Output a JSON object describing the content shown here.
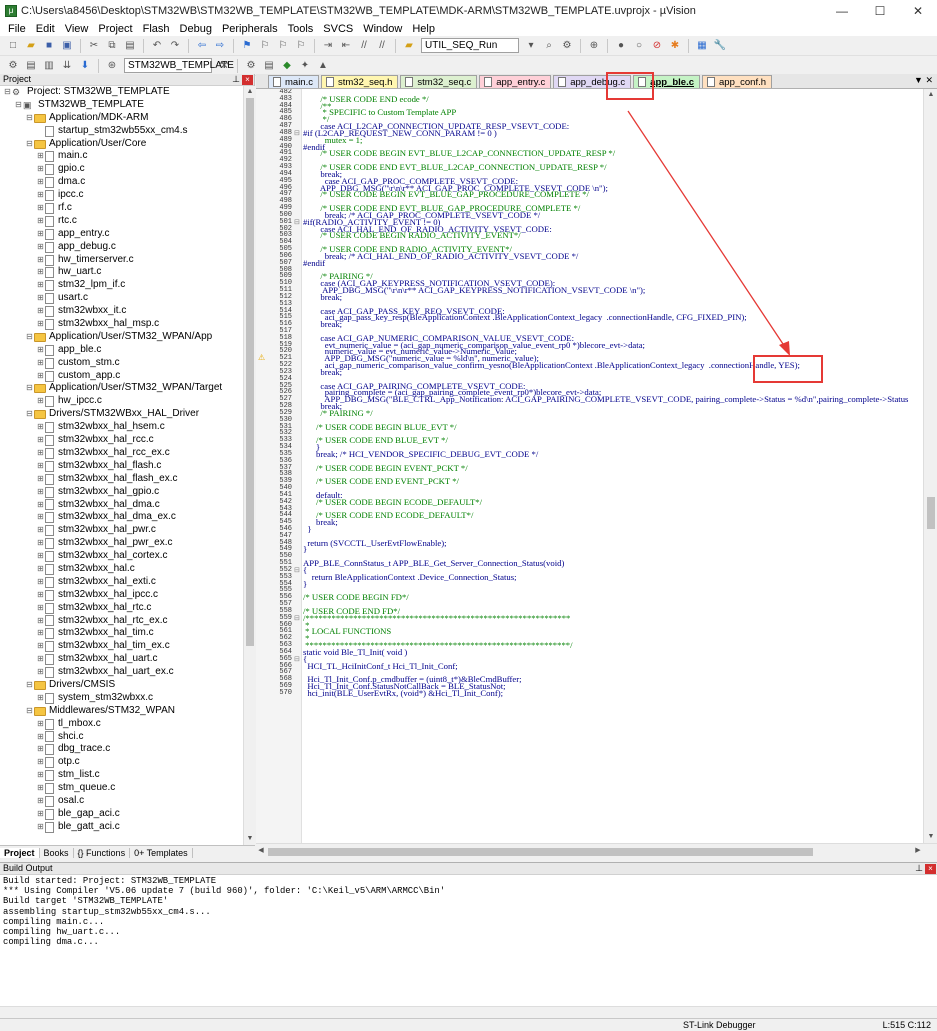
{
  "window": {
    "title": "C:\\Users\\a8456\\Desktop\\STM32WB\\STM32WB_TEMPLATE\\STM32WB_TEMPLATE\\MDK-ARM\\STM32WB_TEMPLATE.uvprojx - µVision",
    "minimize": "—",
    "maximize": "☐",
    "close": "✕"
  },
  "menu": [
    "File",
    "Edit",
    "View",
    "Project",
    "Flash",
    "Debug",
    "Peripherals",
    "Tools",
    "SVCS",
    "Window",
    "Help"
  ],
  "toolbar": {
    "function_combo": "UTIL_SEQ_Run",
    "target_combo": "STM32WB_TEMPLATE"
  },
  "project_panel": {
    "title": "Project",
    "tree": [
      {
        "level": 0,
        "type": "proj",
        "toggle": "⊟",
        "label": "Project: STM32WB_TEMPLATE"
      },
      {
        "level": 1,
        "type": "target",
        "toggle": "⊟",
        "label": "STM32WB_TEMPLATE"
      },
      {
        "level": 2,
        "type": "folder",
        "toggle": "⊟",
        "label": "Application/MDK-ARM"
      },
      {
        "level": 3,
        "type": "file",
        "toggle": "",
        "label": "startup_stm32wb55xx_cm4.s"
      },
      {
        "level": 2,
        "type": "folder",
        "toggle": "⊟",
        "label": "Application/User/Core"
      },
      {
        "level": 3,
        "type": "file",
        "toggle": "⊞",
        "label": "main.c"
      },
      {
        "level": 3,
        "type": "file",
        "toggle": "⊞",
        "label": "gpio.c"
      },
      {
        "level": 3,
        "type": "file",
        "toggle": "⊞",
        "label": "dma.c"
      },
      {
        "level": 3,
        "type": "file",
        "toggle": "⊞",
        "label": "ipcc.c"
      },
      {
        "level": 3,
        "type": "file",
        "toggle": "⊞",
        "label": "rf.c"
      },
      {
        "level": 3,
        "type": "file",
        "toggle": "⊞",
        "label": "rtc.c"
      },
      {
        "level": 3,
        "type": "file",
        "toggle": "⊞",
        "label": "app_entry.c"
      },
      {
        "level": 3,
        "type": "file",
        "toggle": "⊞",
        "label": "app_debug.c"
      },
      {
        "level": 3,
        "type": "file",
        "toggle": "⊞",
        "label": "hw_timerserver.c"
      },
      {
        "level": 3,
        "type": "file",
        "toggle": "⊞",
        "label": "hw_uart.c"
      },
      {
        "level": 3,
        "type": "file",
        "toggle": "⊞",
        "label": "stm32_lpm_if.c"
      },
      {
        "level": 3,
        "type": "file",
        "toggle": "⊞",
        "label": "usart.c"
      },
      {
        "level": 3,
        "type": "file",
        "toggle": "⊞",
        "label": "stm32wbxx_it.c"
      },
      {
        "level": 3,
        "type": "file",
        "toggle": "⊞",
        "label": "stm32wbxx_hal_msp.c"
      },
      {
        "level": 2,
        "type": "folder",
        "toggle": "⊟",
        "label": "Application/User/STM32_WPAN/App"
      },
      {
        "level": 3,
        "type": "file",
        "toggle": "⊞",
        "label": "app_ble.c"
      },
      {
        "level": 3,
        "type": "file",
        "toggle": "⊞",
        "label": "custom_stm.c"
      },
      {
        "level": 3,
        "type": "file",
        "toggle": "⊞",
        "label": "custom_app.c"
      },
      {
        "level": 2,
        "type": "folder",
        "toggle": "⊟",
        "label": "Application/User/STM32_WPAN/Target"
      },
      {
        "level": 3,
        "type": "file",
        "toggle": "⊞",
        "label": "hw_ipcc.c"
      },
      {
        "level": 2,
        "type": "folder",
        "toggle": "⊟",
        "label": "Drivers/STM32WBxx_HAL_Driver"
      },
      {
        "level": 3,
        "type": "file",
        "toggle": "⊞",
        "label": "stm32wbxx_hal_hsem.c"
      },
      {
        "level": 3,
        "type": "file",
        "toggle": "⊞",
        "label": "stm32wbxx_hal_rcc.c"
      },
      {
        "level": 3,
        "type": "file",
        "toggle": "⊞",
        "label": "stm32wbxx_hal_rcc_ex.c"
      },
      {
        "level": 3,
        "type": "file",
        "toggle": "⊞",
        "label": "stm32wbxx_hal_flash.c"
      },
      {
        "level": 3,
        "type": "file",
        "toggle": "⊞",
        "label": "stm32wbxx_hal_flash_ex.c"
      },
      {
        "level": 3,
        "type": "file",
        "toggle": "⊞",
        "label": "stm32wbxx_hal_gpio.c"
      },
      {
        "level": 3,
        "type": "file",
        "toggle": "⊞",
        "label": "stm32wbxx_hal_dma.c"
      },
      {
        "level": 3,
        "type": "file",
        "toggle": "⊞",
        "label": "stm32wbxx_hal_dma_ex.c"
      },
      {
        "level": 3,
        "type": "file",
        "toggle": "⊞",
        "label": "stm32wbxx_hal_pwr.c"
      },
      {
        "level": 3,
        "type": "file",
        "toggle": "⊞",
        "label": "stm32wbxx_hal_pwr_ex.c"
      },
      {
        "level": 3,
        "type": "file",
        "toggle": "⊞",
        "label": "stm32wbxx_hal_cortex.c"
      },
      {
        "level": 3,
        "type": "file",
        "toggle": "⊞",
        "label": "stm32wbxx_hal.c"
      },
      {
        "level": 3,
        "type": "file",
        "toggle": "⊞",
        "label": "stm32wbxx_hal_exti.c"
      },
      {
        "level": 3,
        "type": "file",
        "toggle": "⊞",
        "label": "stm32wbxx_hal_ipcc.c"
      },
      {
        "level": 3,
        "type": "file",
        "toggle": "⊞",
        "label": "stm32wbxx_hal_rtc.c"
      },
      {
        "level": 3,
        "type": "file",
        "toggle": "⊞",
        "label": "stm32wbxx_hal_rtc_ex.c"
      },
      {
        "level": 3,
        "type": "file",
        "toggle": "⊞",
        "label": "stm32wbxx_hal_tim.c"
      },
      {
        "level": 3,
        "type": "file",
        "toggle": "⊞",
        "label": "stm32wbxx_hal_tim_ex.c"
      },
      {
        "level": 3,
        "type": "file",
        "toggle": "⊞",
        "label": "stm32wbxx_hal_uart.c"
      },
      {
        "level": 3,
        "type": "file",
        "toggle": "⊞",
        "label": "stm32wbxx_hal_uart_ex.c"
      },
      {
        "level": 2,
        "type": "folder",
        "toggle": "⊟",
        "label": "Drivers/CMSIS"
      },
      {
        "level": 3,
        "type": "file",
        "toggle": "⊞",
        "label": "system_stm32wbxx.c"
      },
      {
        "level": 2,
        "type": "folder",
        "toggle": "⊟",
        "label": "Middlewares/STM32_WPAN"
      },
      {
        "level": 3,
        "type": "file",
        "toggle": "⊞",
        "label": "tl_mbox.c"
      },
      {
        "level": 3,
        "type": "file",
        "toggle": "⊞",
        "label": "shci.c"
      },
      {
        "level": 3,
        "type": "file",
        "toggle": "⊞",
        "label": "dbg_trace.c"
      },
      {
        "level": 3,
        "type": "file",
        "toggle": "⊞",
        "label": "otp.c"
      },
      {
        "level": 3,
        "type": "file",
        "toggle": "⊞",
        "label": "stm_list.c"
      },
      {
        "level": 3,
        "type": "file",
        "toggle": "⊞",
        "label": "stm_queue.c"
      },
      {
        "level": 3,
        "type": "file",
        "toggle": "⊞",
        "label": "osal.c"
      },
      {
        "level": 3,
        "type": "file",
        "toggle": "⊞",
        "label": "ble_gap_aci.c"
      },
      {
        "level": 3,
        "type": "file",
        "toggle": "⊞",
        "label": "ble_gatt_aci.c"
      }
    ],
    "tabs": [
      "Project",
      "Books",
      "{} Functions",
      "0+ Templates"
    ]
  },
  "editor_tabs": [
    {
      "label": "main.c",
      "color": "#dde8f8"
    },
    {
      "label": "stm32_seq.h",
      "color": "#fff6b0"
    },
    {
      "label": "stm32_seq.c",
      "color": "#ddf0d0"
    },
    {
      "label": "app_entry.c",
      "color": "#ffd0d8"
    },
    {
      "label": "app_debug.c",
      "color": "#e0d8f4"
    },
    {
      "label": "app_ble.c",
      "color": "#c5f3c5",
      "active": true
    },
    {
      "label": "app_conf.h",
      "color": "#ffe0c0"
    }
  ],
  "code": [
    {
      "n": "482",
      "g": "",
      "t": ""
    },
    {
      "n": "483",
      "g": "",
      "t": "        /* USER CODE END ecode */",
      "c": "cmt"
    },
    {
      "n": "484",
      "g": "",
      "t": "        /**",
      "c": "cmt"
    },
    {
      "n": "485",
      "g": "",
      "t": "         * SPECIFIC to Custom Template APP",
      "c": "cmt"
    },
    {
      "n": "486",
      "g": "",
      "t": "         */",
      "c": "cmt"
    },
    {
      "n": "487",
      "g": "",
      "t": "        case ACI_L2CAP_CONNECTION_UPDATE_RESP_VSEVT_CODE:"
    },
    {
      "n": "488",
      "g": "⊟",
      "t": "#if (L2CAP_REQUEST_NEW_CONN_PARAM != 0 )"
    },
    {
      "n": "489",
      "g": "",
      "t": "          mutex = 1;",
      "c": "cmt"
    },
    {
      "n": "490",
      "g": "",
      "t": "#endif"
    },
    {
      "n": "491",
      "g": "",
      "t": "        /* USER CODE BEGIN EVT_BLUE_L2CAP_CONNECTION_UPDATE_RESP */",
      "c": "cmt"
    },
    {
      "n": "492",
      "g": "",
      "t": ""
    },
    {
      "n": "493",
      "g": "",
      "t": "        /* USER CODE END EVT_BLUE_L2CAP_CONNECTION_UPDATE_RESP */",
      "c": "cmt"
    },
    {
      "n": "494",
      "g": "",
      "t": "        break;"
    },
    {
      "n": "495",
      "g": "",
      "t": "          case ACI_GAP_PROC_COMPLETE_VSEVT_CODE:"
    },
    {
      "n": "496",
      "g": "",
      "t": "        APP_DBG_MSG(\"\\r\\n\\r** ACI_GAP_PROC_COMPLETE_VSEVT_CODE \\n\");"
    },
    {
      "n": "497",
      "g": "",
      "t": "        /* USER CODE BEGIN EVT_BLUE_GAP_PROCEDURE_COMPLETE */",
      "c": "cmt"
    },
    {
      "n": "498",
      "g": "",
      "t": ""
    },
    {
      "n": "499",
      "g": "",
      "t": "        /* USER CODE END EVT_BLUE_GAP_PROCEDURE_COMPLETE */",
      "c": "cmt"
    },
    {
      "n": "500",
      "g": "",
      "t": "          break; /* ACI_GAP_PROC_COMPLETE_VSEVT_CODE */"
    },
    {
      "n": "501",
      "g": "⊟",
      "t": "#if(RADIO_ACTIVITY_EVENT != 0)"
    },
    {
      "n": "502",
      "g": "",
      "t": "        case ACI_HAL_END_OF_RADIO_ACTIVITY_VSEVT_CODE:"
    },
    {
      "n": "503",
      "g": "",
      "t": "        /* USER CODE BEGIN RADIO_ACTIVITY_EVENT*/",
      "c": "cmt"
    },
    {
      "n": "504",
      "g": "",
      "t": ""
    },
    {
      "n": "505",
      "g": "",
      "t": "        /* USER CODE END RADIO_ACTIVITY_EVENT*/",
      "c": "cmt"
    },
    {
      "n": "506",
      "g": "",
      "t": "          break; /* ACI_HAL_END_OF_RADIO_ACTIVITY_VSEVT_CODE */"
    },
    {
      "n": "507",
      "g": "",
      "t": "#endif"
    },
    {
      "n": "508",
      "g": "",
      "t": ""
    },
    {
      "n": "509",
      "g": "",
      "t": "        /* PAIRING */",
      "c": "cmt"
    },
    {
      "n": "510",
      "g": "",
      "t": "        case (ACI_GAP_KEYPRESS_NOTIFICATION_VSEVT_CODE):"
    },
    {
      "n": "511",
      "g": "",
      "t": "         APP_DBG_MSG(\"\\r\\n\\r** ACI_GAP_KEYPRESS_NOTIFICATION_VSEVT_CODE \\n\");"
    },
    {
      "n": "512",
      "g": "",
      "t": "        break;"
    },
    {
      "n": "513",
      "g": "",
      "t": ""
    },
    {
      "n": "514",
      "g": "",
      "t": "        case ACI_GAP_PASS_KEY_REQ_VSEVT_CODE:"
    },
    {
      "n": "515",
      "g": "",
      "t": "          aci_gap_pass_key_resp(BleApplicationContext .BleApplicationContext_legacy  .connectionHandle, CFG_FIXED_PIN);"
    },
    {
      "n": "516",
      "g": "",
      "t": "        break;"
    },
    {
      "n": "517",
      "g": "",
      "t": ""
    },
    {
      "n": "518",
      "g": "",
      "t": "        case ACI_GAP_NUMERIC_COMPARISON_VALUE_VSEVT_CODE:"
    },
    {
      "n": "519",
      "g": "",
      "t": "          evt_numeric_value = (aci_gap_numeric_comparison_value_event_rp0 *)blecore_evt->data;"
    },
    {
      "n": "520",
      "g": "",
      "t": "          numeric_value = evt_numeric_value->Numeric_Value;"
    },
    {
      "n": "521",
      "g": "",
      "w": "⚠",
      "t": "          APP_DBG_MSG(\"numeric_value = %ld\\n\", numeric_value);"
    },
    {
      "n": "522",
      "g": "",
      "t": "          aci_gap_numeric_comparison_value_confirm_yesno(BleApplicationContext .BleApplicationContext_legacy  .connectionHandle, YES);"
    },
    {
      "n": "523",
      "g": "",
      "t": "        break;"
    },
    {
      "n": "524",
      "g": "",
      "t": ""
    },
    {
      "n": "525",
      "g": "",
      "t": "        case ACI_GAP_PAIRING_COMPLETE_VSEVT_CODE:"
    },
    {
      "n": "526",
      "g": "",
      "t": "          pairing_complete = (aci_gap_pairing_complete_event_rp0*)blecore_evt->data;"
    },
    {
      "n": "527",
      "g": "",
      "t": "          APP_DBG_MSG(\"BLE_CTRL_App_Notification: ACI_GAP_PAIRING_COMPLETE_VSEVT_CODE, pairing_complete->Status = %d\\n\",pairing_complete->Status"
    },
    {
      "n": "528",
      "g": "",
      "t": "        break;"
    },
    {
      "n": "529",
      "g": "",
      "t": "        /* PAIRING */",
      "c": "cmt"
    },
    {
      "n": "530",
      "g": "",
      "t": ""
    },
    {
      "n": "531",
      "g": "",
      "t": "      /* USER CODE BEGIN BLUE_EVT */",
      "c": "cmt"
    },
    {
      "n": "532",
      "g": "",
      "t": ""
    },
    {
      "n": "533",
      "g": "",
      "t": "      /* USER CODE END BLUE_EVT */",
      "c": "cmt"
    },
    {
      "n": "534",
      "g": "",
      "t": "      }"
    },
    {
      "n": "535",
      "g": "",
      "t": "      break; /* HCI_VENDOR_SPECIFIC_DEBUG_EVT_CODE */"
    },
    {
      "n": "536",
      "g": "",
      "t": ""
    },
    {
      "n": "537",
      "g": "",
      "t": "      /* USER CODE BEGIN EVENT_PCKT */",
      "c": "cmt"
    },
    {
      "n": "538",
      "g": "",
      "t": ""
    },
    {
      "n": "539",
      "g": "",
      "t": "      /* USER CODE END EVENT_PCKT */",
      "c": "cmt"
    },
    {
      "n": "540",
      "g": "",
      "t": ""
    },
    {
      "n": "541",
      "g": "",
      "t": "      default:"
    },
    {
      "n": "542",
      "g": "",
      "t": "      /* USER CODE BEGIN ECODE_DEFAULT*/",
      "c": "cmt"
    },
    {
      "n": "543",
      "g": "",
      "t": ""
    },
    {
      "n": "544",
      "g": "",
      "t": "      /* USER CODE END ECODE_DEFAULT*/",
      "c": "cmt"
    },
    {
      "n": "545",
      "g": "",
      "t": "      break;"
    },
    {
      "n": "546",
      "g": "",
      "t": "  }"
    },
    {
      "n": "547",
      "g": "",
      "t": ""
    },
    {
      "n": "548",
      "g": "",
      "t": "  return (SVCCTL_UserEvtFlowEnable);"
    },
    {
      "n": "549",
      "g": "",
      "t": "}"
    },
    {
      "n": "550",
      "g": "",
      "t": ""
    },
    {
      "n": "551",
      "g": "",
      "t": "APP_BLE_ConnStatus_t APP_BLE_Get_Server_Connection_Status(void)"
    },
    {
      "n": "552",
      "g": "⊟",
      "t": "{"
    },
    {
      "n": "553",
      "g": "",
      "t": "    return BleApplicationContext .Device_Connection_Status;"
    },
    {
      "n": "554",
      "g": "",
      "t": "}"
    },
    {
      "n": "555",
      "g": "",
      "t": ""
    },
    {
      "n": "556",
      "g": "",
      "t": "/* USER CODE BEGIN FD*/",
      "c": "cmt"
    },
    {
      "n": "557",
      "g": "",
      "t": ""
    },
    {
      "n": "558",
      "g": "",
      "t": "/* USER CODE END FD*/",
      "c": "cmt"
    },
    {
      "n": "559",
      "g": "⊟",
      "t": "/*************************************************************",
      "c": "cmt"
    },
    {
      "n": "560",
      "g": "",
      "t": " *",
      "c": "cmt"
    },
    {
      "n": "561",
      "g": "",
      "t": " * LOCAL FUNCTIONS",
      "c": "cmt"
    },
    {
      "n": "562",
      "g": "",
      "t": " *",
      "c": "cmt"
    },
    {
      "n": "563",
      "g": "",
      "t": " *************************************************************/",
      "c": "cmt"
    },
    {
      "n": "564",
      "g": "",
      "t": "static void Ble_Tl_Init( void )"
    },
    {
      "n": "565",
      "g": "⊟",
      "t": "{"
    },
    {
      "n": "566",
      "g": "",
      "t": "  HCI_TL_HciInitConf_t Hci_Tl_Init_Conf;"
    },
    {
      "n": "567",
      "g": "",
      "t": ""
    },
    {
      "n": "568",
      "g": "",
      "t": "  Hci_Tl_Init_Conf.p_cmdbuffer = (uint8_t*)&BleCmdBuffer;"
    },
    {
      "n": "569",
      "g": "",
      "t": "  Hci_Tl_Init_Conf.StatusNotCallBack = BLE_StatusNot;"
    },
    {
      "n": "570",
      "g": "",
      "t": "  hci_init(BLE_UserEvtRx, (void*) &Hci_Tl_Init_Conf);"
    }
  ],
  "build_output": {
    "title": "Build Output",
    "lines": [
      "Build started: Project: STM32WB_TEMPLATE",
      "*** Using Compiler 'V5.06 update 7 (build 960)', folder: 'C:\\Keil_v5\\ARM\\ARMCC\\Bin'",
      "Build target 'STM32WB_TEMPLATE'",
      "assembling startup_stm32wb55xx_cm4.s...",
      "compiling main.c...",
      "compiling hw_uart.c...",
      "compiling dma.c..."
    ]
  },
  "status": {
    "debugger": "ST-Link Debugger",
    "position": "L:515 C:112"
  }
}
